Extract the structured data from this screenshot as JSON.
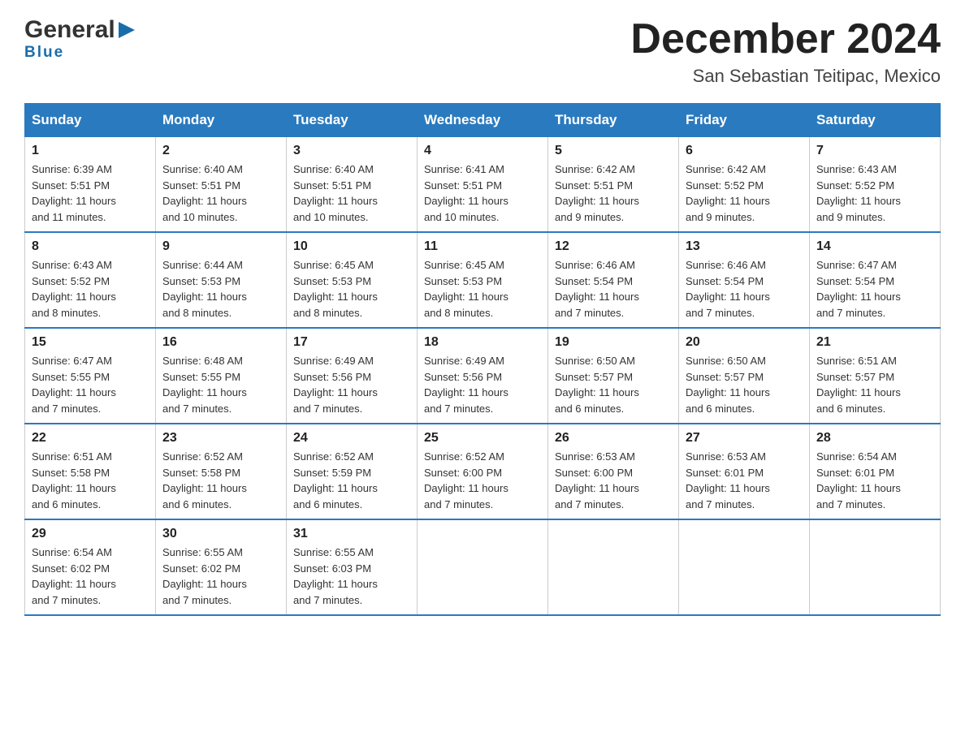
{
  "header": {
    "logo_general": "General",
    "logo_blue": "Blue",
    "month_title": "December 2024",
    "location": "San Sebastian Teitipac, Mexico"
  },
  "days_of_week": [
    "Sunday",
    "Monday",
    "Tuesday",
    "Wednesday",
    "Thursday",
    "Friday",
    "Saturday"
  ],
  "weeks": [
    [
      {
        "day": "1",
        "sunrise": "6:39 AM",
        "sunset": "5:51 PM",
        "daylight": "11 hours and 11 minutes."
      },
      {
        "day": "2",
        "sunrise": "6:40 AM",
        "sunset": "5:51 PM",
        "daylight": "11 hours and 10 minutes."
      },
      {
        "day": "3",
        "sunrise": "6:40 AM",
        "sunset": "5:51 PM",
        "daylight": "11 hours and 10 minutes."
      },
      {
        "day": "4",
        "sunrise": "6:41 AM",
        "sunset": "5:51 PM",
        "daylight": "11 hours and 10 minutes."
      },
      {
        "day": "5",
        "sunrise": "6:42 AM",
        "sunset": "5:51 PM",
        "daylight": "11 hours and 9 minutes."
      },
      {
        "day": "6",
        "sunrise": "6:42 AM",
        "sunset": "5:52 PM",
        "daylight": "11 hours and 9 minutes."
      },
      {
        "day": "7",
        "sunrise": "6:43 AM",
        "sunset": "5:52 PM",
        "daylight": "11 hours and 9 minutes."
      }
    ],
    [
      {
        "day": "8",
        "sunrise": "6:43 AM",
        "sunset": "5:52 PM",
        "daylight": "11 hours and 8 minutes."
      },
      {
        "day": "9",
        "sunrise": "6:44 AM",
        "sunset": "5:53 PM",
        "daylight": "11 hours and 8 minutes."
      },
      {
        "day": "10",
        "sunrise": "6:45 AM",
        "sunset": "5:53 PM",
        "daylight": "11 hours and 8 minutes."
      },
      {
        "day": "11",
        "sunrise": "6:45 AM",
        "sunset": "5:53 PM",
        "daylight": "11 hours and 8 minutes."
      },
      {
        "day": "12",
        "sunrise": "6:46 AM",
        "sunset": "5:54 PM",
        "daylight": "11 hours and 7 minutes."
      },
      {
        "day": "13",
        "sunrise": "6:46 AM",
        "sunset": "5:54 PM",
        "daylight": "11 hours and 7 minutes."
      },
      {
        "day": "14",
        "sunrise": "6:47 AM",
        "sunset": "5:54 PM",
        "daylight": "11 hours and 7 minutes."
      }
    ],
    [
      {
        "day": "15",
        "sunrise": "6:47 AM",
        "sunset": "5:55 PM",
        "daylight": "11 hours and 7 minutes."
      },
      {
        "day": "16",
        "sunrise": "6:48 AM",
        "sunset": "5:55 PM",
        "daylight": "11 hours and 7 minutes."
      },
      {
        "day": "17",
        "sunrise": "6:49 AM",
        "sunset": "5:56 PM",
        "daylight": "11 hours and 7 minutes."
      },
      {
        "day": "18",
        "sunrise": "6:49 AM",
        "sunset": "5:56 PM",
        "daylight": "11 hours and 7 minutes."
      },
      {
        "day": "19",
        "sunrise": "6:50 AM",
        "sunset": "5:57 PM",
        "daylight": "11 hours and 6 minutes."
      },
      {
        "day": "20",
        "sunrise": "6:50 AM",
        "sunset": "5:57 PM",
        "daylight": "11 hours and 6 minutes."
      },
      {
        "day": "21",
        "sunrise": "6:51 AM",
        "sunset": "5:57 PM",
        "daylight": "11 hours and 6 minutes."
      }
    ],
    [
      {
        "day": "22",
        "sunrise": "6:51 AM",
        "sunset": "5:58 PM",
        "daylight": "11 hours and 6 minutes."
      },
      {
        "day": "23",
        "sunrise": "6:52 AM",
        "sunset": "5:58 PM",
        "daylight": "11 hours and 6 minutes."
      },
      {
        "day": "24",
        "sunrise": "6:52 AM",
        "sunset": "5:59 PM",
        "daylight": "11 hours and 6 minutes."
      },
      {
        "day": "25",
        "sunrise": "6:52 AM",
        "sunset": "6:00 PM",
        "daylight": "11 hours and 7 minutes."
      },
      {
        "day": "26",
        "sunrise": "6:53 AM",
        "sunset": "6:00 PM",
        "daylight": "11 hours and 7 minutes."
      },
      {
        "day": "27",
        "sunrise": "6:53 AM",
        "sunset": "6:01 PM",
        "daylight": "11 hours and 7 minutes."
      },
      {
        "day": "28",
        "sunrise": "6:54 AM",
        "sunset": "6:01 PM",
        "daylight": "11 hours and 7 minutes."
      }
    ],
    [
      {
        "day": "29",
        "sunrise": "6:54 AM",
        "sunset": "6:02 PM",
        "daylight": "11 hours and 7 minutes."
      },
      {
        "day": "30",
        "sunrise": "6:55 AM",
        "sunset": "6:02 PM",
        "daylight": "11 hours and 7 minutes."
      },
      {
        "day": "31",
        "sunrise": "6:55 AM",
        "sunset": "6:03 PM",
        "daylight": "11 hours and 7 minutes."
      },
      null,
      null,
      null,
      null
    ]
  ],
  "labels": {
    "sunrise_prefix": "Sunrise: ",
    "sunset_prefix": "Sunset: ",
    "daylight_prefix": "Daylight: "
  }
}
